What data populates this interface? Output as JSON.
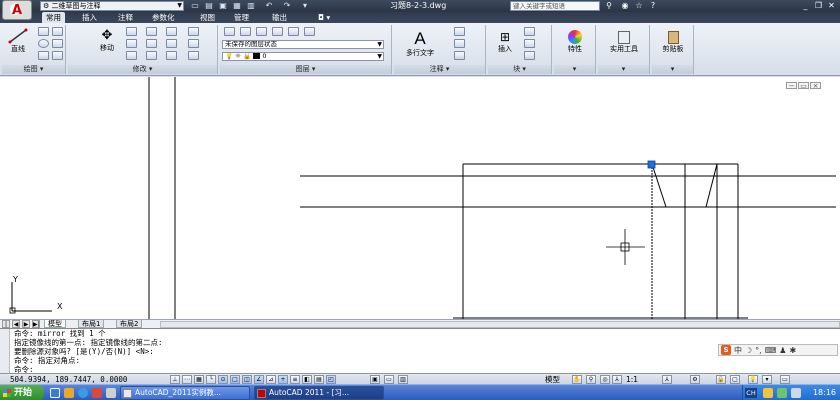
{
  "titlebar": {
    "workspace": "二维草图与注释",
    "document_title": "习题8-2-3.dwg",
    "search_placeholder": "键入关键字或短语"
  },
  "ribbon_tabs": [
    "常用",
    "插入",
    "注释",
    "参数化",
    "视图",
    "管理",
    "输出"
  ],
  "ribbon": {
    "draw": {
      "line": "直线",
      "title": "绘图"
    },
    "modify": {
      "move": "移动",
      "title": "修改"
    },
    "layers": {
      "state": "未保存的图层状态",
      "current_layer": "0",
      "title": "图层"
    },
    "annotation": {
      "mtext": "多行文字",
      "title": "注释"
    },
    "block": {
      "insert": "插入",
      "title": "块"
    },
    "properties": {
      "label": "特性"
    },
    "utilities": {
      "label": "实用工具"
    },
    "clipboard": {
      "label": "剪贴板"
    }
  },
  "layout_tabs": [
    "模型",
    "布局1",
    "布局2"
  ],
  "command_lines": [
    "命令:  mirror 找到 1 个",
    "指定镜像线的第一点: 指定镜像线的第二点:",
    "要删除源对象吗? [是(Y)/否(N)] <N>:",
    "命令: 指定对角点:",
    "命令:"
  ],
  "ime": {
    "label": "中"
  },
  "statusbar": {
    "coordinates": "504.9394, 189.7447, 0.0000",
    "model": "模型",
    "scale": "1:1"
  },
  "taskbar": {
    "start": "开始",
    "items": [
      "AutoCAD_2011实例教...",
      "AutoCAD 2011 - [习..."
    ],
    "tray_lang": "CH",
    "clock": "18:16"
  },
  "ucs": {
    "x": "X",
    "y": "Y"
  },
  "colors": {
    "accent": "#2a5bbf",
    "grip": "#1e6fe0",
    "brand": "#c00000"
  }
}
